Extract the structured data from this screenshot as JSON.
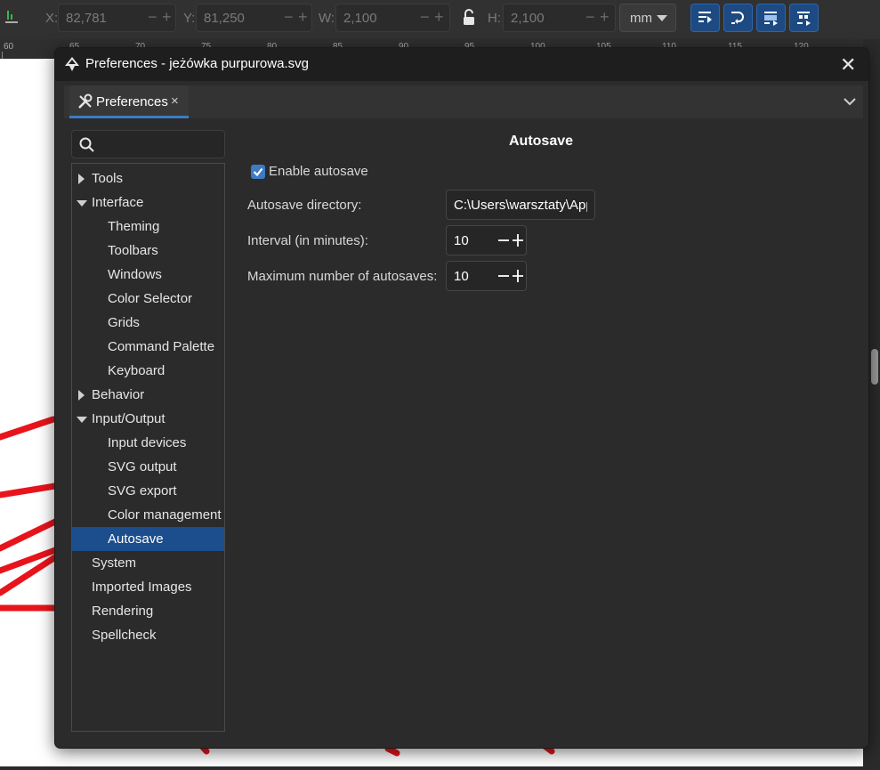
{
  "toolbar": {
    "x": {
      "label": "X:",
      "value": "82,781"
    },
    "y": {
      "label": "Y:",
      "value": "81,250"
    },
    "w": {
      "label": "W:",
      "value": "2,100"
    },
    "h": {
      "label": "H:",
      "value": "2,100"
    },
    "unit": "mm"
  },
  "ruler": {
    "ticks": [
      "60",
      "65",
      "70",
      "75",
      "80",
      "85",
      "90",
      "95",
      "100",
      "105",
      "110",
      "115",
      "120"
    ]
  },
  "dialog": {
    "title": "Preferences - jeżówka purpurowa.svg",
    "tab_label": "Preferences"
  },
  "search": {
    "value": ""
  },
  "tree": {
    "items": [
      {
        "label": "Tools",
        "expander": "collapsed",
        "indent": 0
      },
      {
        "label": "Interface",
        "expander": "expanded",
        "indent": 0
      },
      {
        "label": "Theming",
        "expander": "none",
        "indent": 1
      },
      {
        "label": "Toolbars",
        "expander": "none",
        "indent": 1
      },
      {
        "label": "Windows",
        "expander": "none",
        "indent": 1
      },
      {
        "label": "Color Selector",
        "expander": "none",
        "indent": 1
      },
      {
        "label": "Grids",
        "expander": "none",
        "indent": 1
      },
      {
        "label": "Command Palette",
        "expander": "none",
        "indent": 1
      },
      {
        "label": "Keyboard",
        "expander": "none",
        "indent": 1
      },
      {
        "label": "Behavior",
        "expander": "collapsed",
        "indent": 0
      },
      {
        "label": "Input/Output",
        "expander": "expanded",
        "indent": 0
      },
      {
        "label": "Input devices",
        "expander": "none",
        "indent": 1
      },
      {
        "label": "SVG output",
        "expander": "none",
        "indent": 1
      },
      {
        "label": "SVG export",
        "expander": "none",
        "indent": 1
      },
      {
        "label": "Color management",
        "expander": "none",
        "indent": 1
      },
      {
        "label": "Autosave",
        "expander": "none",
        "indent": 1,
        "selected": true
      },
      {
        "label": "System",
        "expander": "none",
        "indent": 0
      },
      {
        "label": "Imported Images",
        "expander": "none",
        "indent": 0
      },
      {
        "label": "Rendering",
        "expander": "none",
        "indent": 0
      },
      {
        "label": "Spellcheck",
        "expander": "none",
        "indent": 0
      }
    ]
  },
  "page": {
    "title": "Autosave",
    "enable_autosave": {
      "label": "Enable autosave",
      "checked": true
    },
    "directory": {
      "label": "Autosave directory:",
      "value": "C:\\Users\\warsztaty\\AppData"
    },
    "interval": {
      "label": "Interval (in minutes):",
      "value": "10"
    },
    "max_autosaves": {
      "label": "Maximum number of autosaves:",
      "value": "10"
    }
  },
  "colors": {
    "accent": "#3d7bc4",
    "selection": "#1c4d8c",
    "canvas_stroke": "#e8141c"
  }
}
